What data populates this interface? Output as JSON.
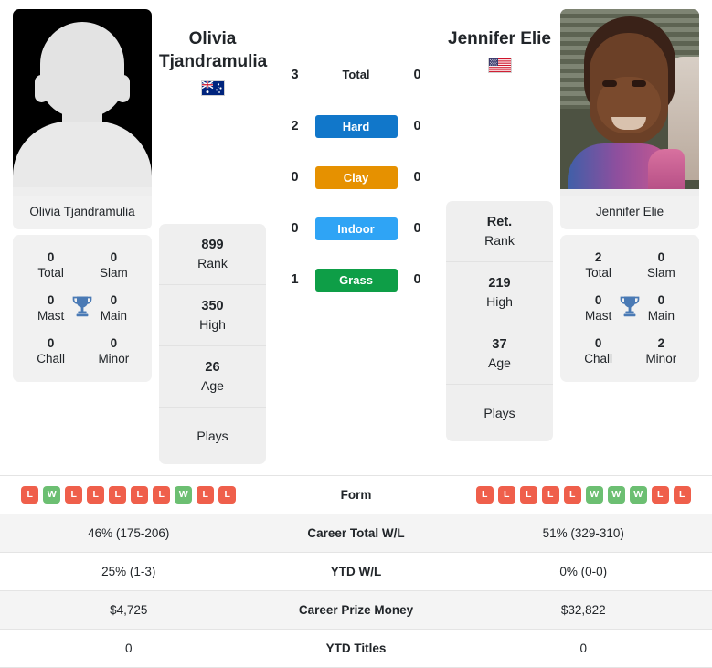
{
  "players": {
    "left": {
      "name": "Olivia Tjandramulia",
      "name_line1": "Olivia",
      "name_line2": "Tjandramulia",
      "photo_caption": "Olivia Tjandramulia",
      "country_flag": "australia-flag",
      "photo_type": "placeholder-silhouette",
      "rank": "899",
      "rank_label": "Rank",
      "high": "350",
      "high_label": "High",
      "age": "26",
      "age_label": "Age",
      "plays_label": "Plays",
      "plays_value": "",
      "titles": {
        "total": "0",
        "total_label": "Total",
        "slam": "0",
        "slam_label": "Slam",
        "mast": "0",
        "mast_label": "Mast",
        "main": "0",
        "main_label": "Main",
        "chall": "0",
        "chall_label": "Chall",
        "minor": "0",
        "minor_label": "Minor"
      },
      "form": [
        "L",
        "W",
        "L",
        "L",
        "L",
        "L",
        "L",
        "W",
        "L",
        "L"
      ],
      "career_total_wl": "46% (175-206)",
      "ytd_wl": "25% (1-3)",
      "career_prize_money": "$4,725",
      "ytd_titles": "0"
    },
    "right": {
      "name": "Jennifer Elie",
      "name_line1": "Jennifer Elie",
      "name_line2": "",
      "photo_caption": "Jennifer Elie",
      "country_flag": "usa-flag",
      "photo_type": "player-photo",
      "rank": "Ret.",
      "rank_label": "Rank",
      "high": "219",
      "high_label": "High",
      "age": "37",
      "age_label": "Age",
      "plays_label": "Plays",
      "plays_value": "",
      "titles": {
        "total": "2",
        "total_label": "Total",
        "slam": "0",
        "slam_label": "Slam",
        "mast": "0",
        "mast_label": "Mast",
        "main": "0",
        "main_label": "Main",
        "chall": "0",
        "chall_label": "Chall",
        "minor": "2",
        "minor_label": "Minor"
      },
      "form": [
        "L",
        "L",
        "L",
        "L",
        "L",
        "W",
        "W",
        "W",
        "L",
        "L"
      ],
      "career_total_wl": "51% (329-310)",
      "ytd_wl": "0% (0-0)",
      "career_prize_money": "$32,822",
      "ytd_titles": "0"
    }
  },
  "head_to_head": [
    {
      "label": "Total",
      "left": "3",
      "right": "0",
      "badge": false,
      "color": ""
    },
    {
      "label": "Hard",
      "left": "2",
      "right": "0",
      "badge": true,
      "color": "#1177ca"
    },
    {
      "label": "Clay",
      "left": "0",
      "right": "0",
      "badge": true,
      "color": "#e69100"
    },
    {
      "label": "Indoor",
      "left": "0",
      "right": "0",
      "badge": true,
      "color": "#2fa4f5"
    },
    {
      "label": "Grass",
      "left": "1",
      "right": "0",
      "badge": true,
      "color": "#0e9e47"
    }
  ],
  "stats_table": {
    "rows": [
      {
        "label": "Form",
        "type": "form"
      },
      {
        "label": "Career Total W/L",
        "type": "text",
        "key": "career_total_wl"
      },
      {
        "label": "YTD W/L",
        "type": "text",
        "key": "ytd_wl"
      },
      {
        "label": "Career Prize Money",
        "type": "text",
        "key": "career_prize_money"
      },
      {
        "label": "YTD Titles",
        "type": "text",
        "key": "ytd_titles"
      }
    ]
  },
  "icons": {
    "trophy": "trophy-icon",
    "trophy_color": "#4a7ab5"
  },
  "colors": {
    "win_badge": "#6cbf72",
    "loss_badge": "#ef5f4b",
    "card_bg": "#f1f1f1",
    "row_alt_bg": "#f4f4f4"
  }
}
